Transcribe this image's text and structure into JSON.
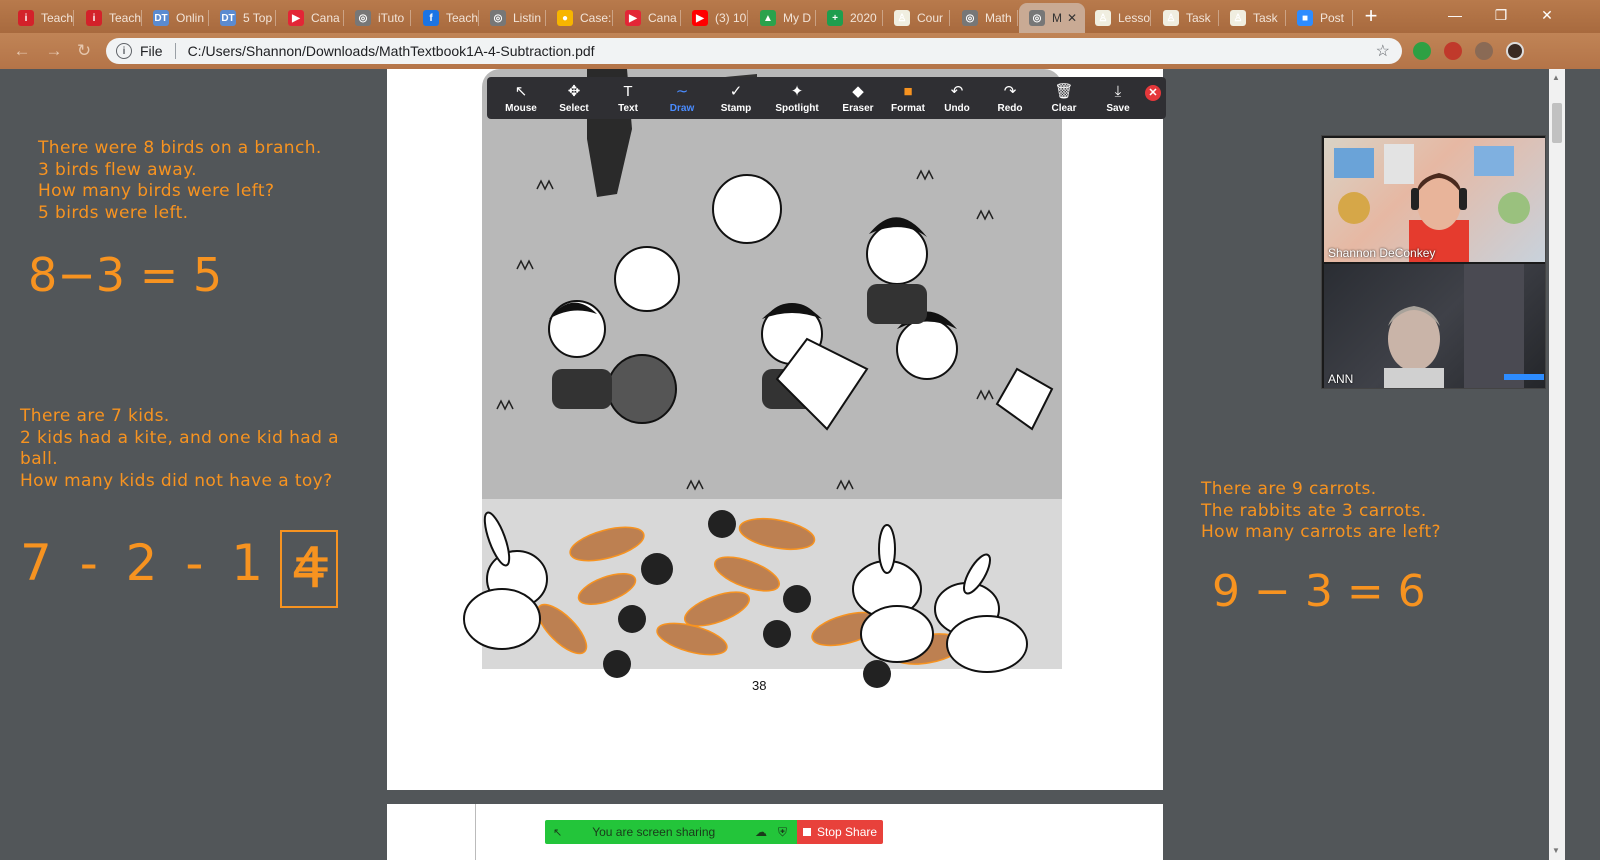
{
  "browser": {
    "tabs": [
      {
        "label": "Teach",
        "fav": "i",
        "color": "#d3222a"
      },
      {
        "label": "Teach",
        "fav": "i",
        "color": "#d3222a"
      },
      {
        "label": "Onlin",
        "fav": "DT",
        "color": "#5b8bd0"
      },
      {
        "label": "5 Top",
        "fav": "DT",
        "color": "#5b8bd0"
      },
      {
        "label": "Cana",
        "fav": "▶",
        "color": "#e32636"
      },
      {
        "label": "iTuto",
        "fav": "◎",
        "color": "#777777"
      },
      {
        "label": "Teach",
        "fav": "f",
        "color": "#1b74e4"
      },
      {
        "label": "Listin",
        "fav": "◎",
        "color": "#777777"
      },
      {
        "label": "Case:",
        "fav": "●",
        "color": "#f7b500"
      },
      {
        "label": "Cana",
        "fav": "▶",
        "color": "#e32636"
      },
      {
        "label": "(3) 10",
        "fav": "▶",
        "color": "#ff0000"
      },
      {
        "label": "My D",
        "fav": "▲",
        "color": "#2ba24c"
      },
      {
        "label": "2020",
        "fav": "+",
        "color": "#1e9e4e"
      },
      {
        "label": "Cour",
        "fav": "♙",
        "color": "#f0eee0"
      },
      {
        "label": "Math",
        "fav": "◎",
        "color": "#777777"
      },
      {
        "label": "M",
        "fav": "◎",
        "color": "#777777",
        "active": true
      },
      {
        "label": "Lesso",
        "fav": "♙",
        "color": "#f0eee0"
      },
      {
        "label": "Task",
        "fav": "♙",
        "color": "#f0eee0"
      },
      {
        "label": "Task",
        "fav": "♙",
        "color": "#f0eee0"
      },
      {
        "label": "Post",
        "fav": "■",
        "color": "#2d8cff"
      }
    ],
    "new_tab": "+",
    "window_controls": {
      "minimize": "—",
      "restore": "❐",
      "close": "✕"
    },
    "address": {
      "scheme_label": "File",
      "url": "C:/Users/Shannon/Downloads/MathTextbook1A-4-Subtraction.pdf"
    }
  },
  "annotate_toolbar": {
    "tools": [
      {
        "name": "mouse",
        "icon": "↖",
        "label": "Mouse"
      },
      {
        "name": "select",
        "icon": "✥",
        "label": "Select"
      },
      {
        "name": "text",
        "icon": "T",
        "label": "Text"
      },
      {
        "name": "draw",
        "icon": "∼",
        "label": "Draw",
        "active": true
      },
      {
        "name": "stamp",
        "icon": "✓",
        "label": "Stamp"
      },
      {
        "name": "spotlight",
        "icon": "✦",
        "label": "Spotlight"
      },
      {
        "name": "eraser",
        "icon": "◆",
        "label": "Eraser"
      },
      {
        "name": "format",
        "icon": "■",
        "label": "Format"
      },
      {
        "name": "undo",
        "icon": "↶",
        "label": "Undo"
      },
      {
        "name": "redo",
        "icon": "↷",
        "label": "Redo"
      },
      {
        "name": "clear",
        "icon": "🗑",
        "label": "Clear"
      },
      {
        "name": "save",
        "icon": "⤓",
        "label": "Save"
      }
    ],
    "close": "✕"
  },
  "pdf": {
    "page_number": "38"
  },
  "annotations": {
    "birds": [
      "There were 8 birds on a branch.",
      "3 birds flew away.",
      "How many birds were left?",
      "5 birds were left."
    ],
    "birds_eq": "8−3 = 5",
    "kids": [
      "There are 7 kids.",
      "2 kids had a kite, and one kid had a",
      "ball.",
      "How many kids did not have a toy?"
    ],
    "kids_eq": "7 - 2 - 1 =",
    "kids_answer": "4",
    "carrots": [
      "There are 9 carrots.",
      "The rabbits ate 3 carrots.",
      "How many carrots are left?"
    ],
    "carrots_eq": "9 − 3 = 6"
  },
  "video": {
    "participants": [
      {
        "name": "Shannon DeConkey"
      },
      {
        "name": "ANN"
      }
    ]
  },
  "share": {
    "status": "You are screen sharing",
    "stop": "Stop Share"
  },
  "colors": {
    "annotation": "#f79320",
    "share_green": "#23c53a",
    "stop_red": "#e8413b",
    "draw_active": "#4a8cff"
  }
}
